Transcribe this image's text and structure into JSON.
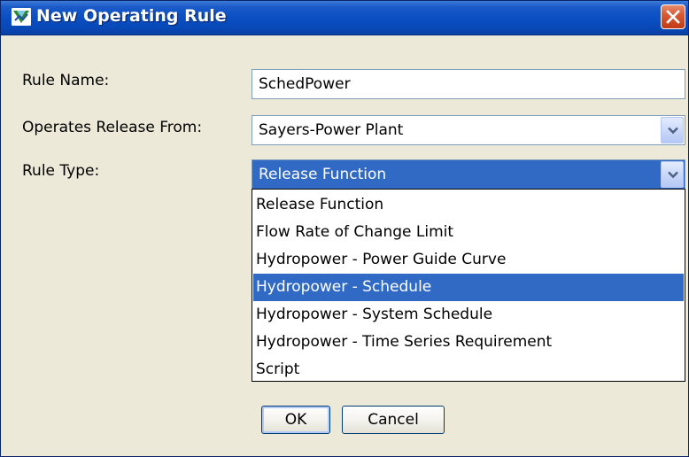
{
  "window": {
    "title": "New Operating Rule"
  },
  "form": {
    "rule_name_label": "Rule Name:",
    "rule_name_value": "SchedPower",
    "operates_label": "Operates Release From:",
    "operates_value": "Sayers-Power Plant",
    "rule_type_label": "Rule Type:",
    "rule_type_value": "Release Function"
  },
  "rule_type_options": [
    "Release Function",
    "Flow Rate of Change Limit",
    "Hydropower - Power Guide Curve",
    "Hydropower - Schedule",
    "Hydropower - System Schedule",
    "Hydropower - Time Series Requirement",
    "Script"
  ],
  "highlighted_option": "Hydropower - Schedule",
  "buttons": {
    "ok": "OK",
    "cancel": "Cancel"
  },
  "colors": {
    "titlebar": "#0a4fc4",
    "selection": "#316ac5",
    "dialog_bg": "#ece9d8",
    "field_border": "#7f9db9",
    "close_button": "#c23b14"
  },
  "icons": {
    "app": "hec-ressim-icon",
    "close": "close-icon",
    "dropdown": "chevron-down-icon"
  }
}
